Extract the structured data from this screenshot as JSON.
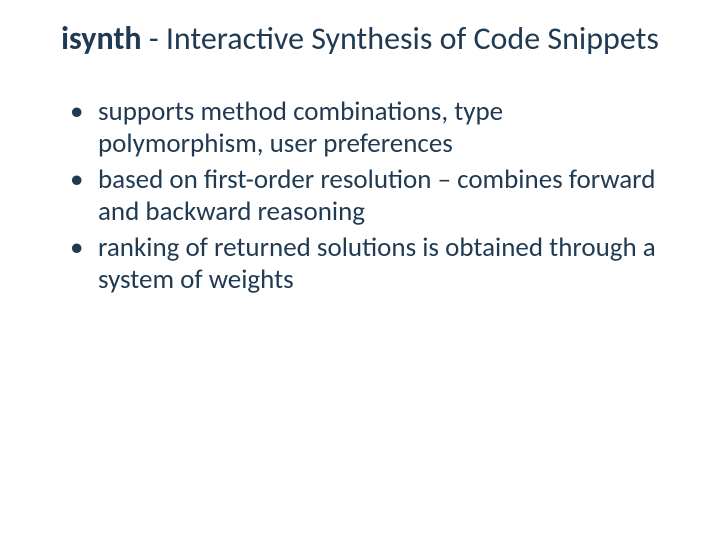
{
  "title": {
    "bold_part": "isynth",
    "rest": " - Interactive Synthesis of Code Snippets"
  },
  "bullets": [
    "supports method combinations, type polymorphism, user preferences",
    "based on first-order resolution – combines forward and backward reasoning",
    "ranking of returned solutions is obtained through a system of weights"
  ]
}
